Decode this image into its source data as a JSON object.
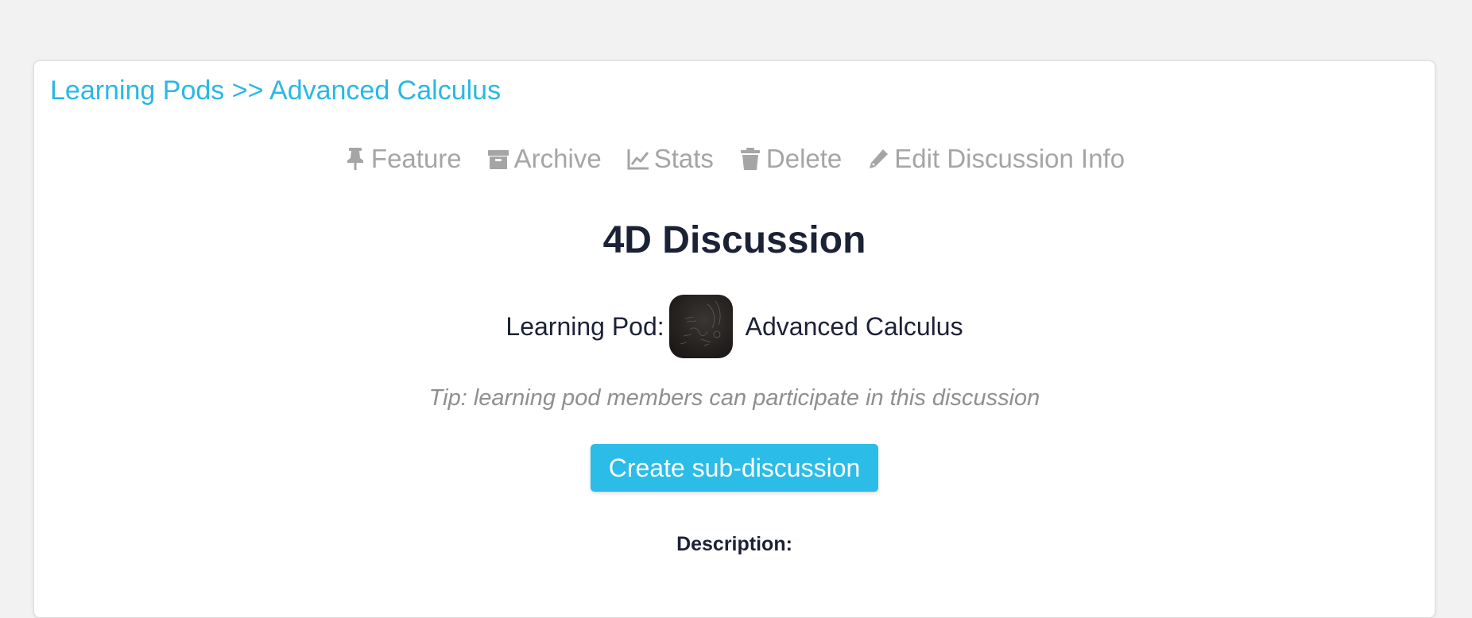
{
  "breadcrumb": {
    "root_label": "Learning Pods",
    "separator": ">>",
    "current_label": "Advanced Calculus"
  },
  "toolbar": {
    "feature_label": "Feature",
    "archive_label": "Archive",
    "stats_label": "Stats",
    "delete_label": "Delete",
    "edit_label": "Edit Discussion Info",
    "icons": [
      "thumbtack-icon",
      "archive-icon",
      "line-chart-icon",
      "trash-icon",
      "pencil-icon"
    ]
  },
  "discussion": {
    "title": "4D Discussion",
    "pod_prefix": "Learning Pod:",
    "pod_name": "Advanced Calculus",
    "tip": "Tip: learning pod members can participate in this discussion",
    "create_button_label": "Create sub-discussion",
    "description_label": "Description:"
  },
  "colors": {
    "accent": "#29b8e6",
    "heading": "#1b2236",
    "muted": "#a5a5a5",
    "background": "#f2f2f2"
  }
}
